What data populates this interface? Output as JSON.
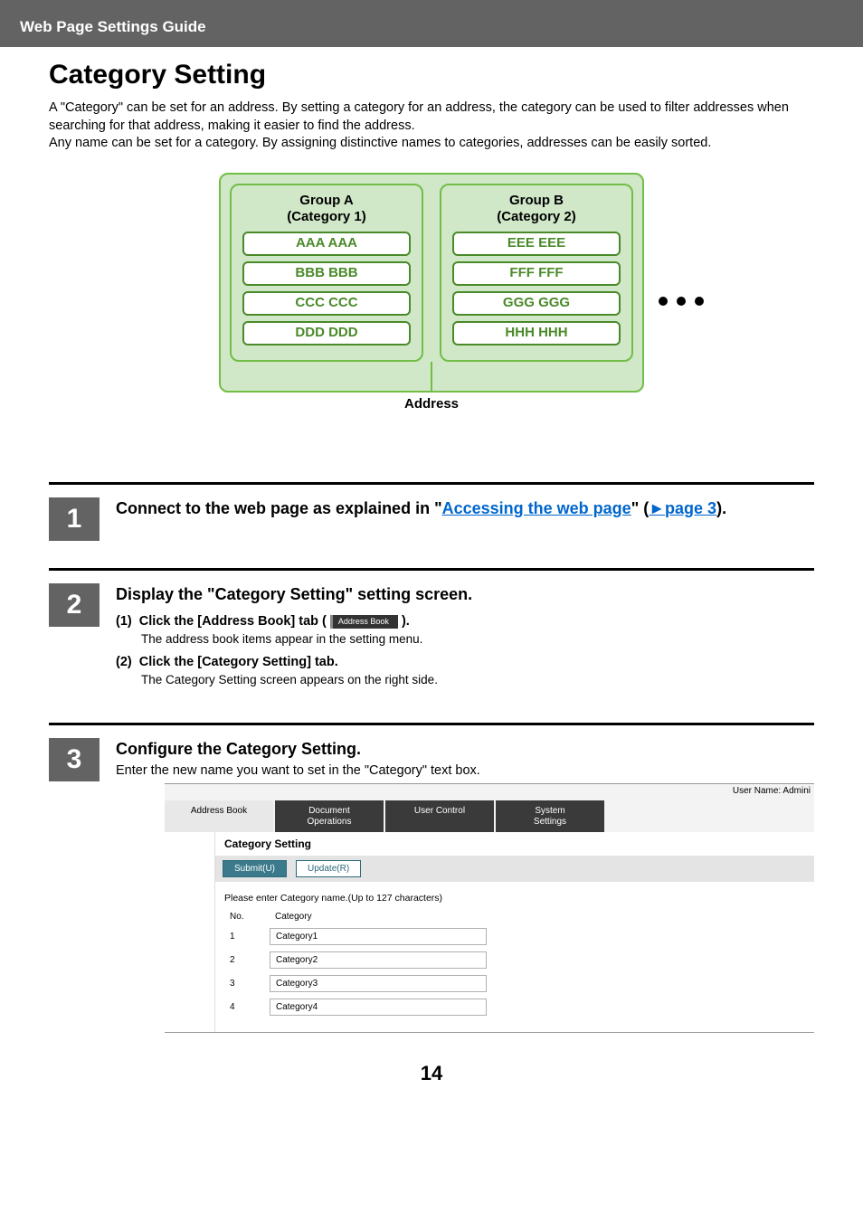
{
  "header": {
    "title": "Web Page Settings Guide"
  },
  "pageTitle": "Category Setting",
  "intro": "A \"Category\" can be set for an address. By setting a category for an address, the category can be used to filter addresses when searching for that address, making it easier to find the address.\nAny name can be set for a category. By assigning distinctive names to categories, addresses can be easily sorted.",
  "diagram": {
    "groupA": {
      "title": "Group A\n(Category 1)",
      "items": [
        "AAA AAA",
        "BBB BBB",
        "CCC CCC",
        "DDD DDD"
      ]
    },
    "groupB": {
      "title": "Group B\n(Category 2)",
      "items": [
        "EEE EEE",
        "FFF FFF",
        "GGG GGG",
        "HHH HHH"
      ]
    },
    "label": "Address"
  },
  "steps": {
    "s1": {
      "num": "1",
      "textBefore": "Connect to the web page as explained in \"",
      "link1": "Accessing the web page",
      "textMid": "\" (",
      "arrow": "►",
      "link2": "page 3",
      "textAfter": ")."
    },
    "s2": {
      "num": "2",
      "head": "Display the \"Category Setting\" setting screen.",
      "p1label": "(1)",
      "p1textA": "Click the [Address Book] tab (",
      "p1chip": "Address Book",
      "p1textB": ").",
      "p1note": "The address book items appear in the setting menu.",
      "p2label": "(2)",
      "p2text": "Click the [Category Setting] tab.",
      "p2note": "The Category Setting screen appears on the right side."
    },
    "s3": {
      "num": "3",
      "head": "Configure the Category Setting.",
      "sub": "Enter the new name you want to set in the \"Category\" text box."
    }
  },
  "shot": {
    "userline": "User Name: Admini",
    "tabs": [
      "Address Book",
      "Document\nOperations",
      "User Control",
      "System\nSettings"
    ],
    "heading": "Category Setting",
    "submit": "Submit(U)",
    "update": "Update(R)",
    "note": "Please enter Category name.(Up to 127 characters)",
    "thNo": "No.",
    "thCat": "Category",
    "rows": [
      {
        "no": "1",
        "val": "Category1"
      },
      {
        "no": "2",
        "val": "Category2"
      },
      {
        "no": "3",
        "val": "Category3"
      },
      {
        "no": "4",
        "val": "Category4"
      }
    ]
  },
  "pageNumber": "14"
}
